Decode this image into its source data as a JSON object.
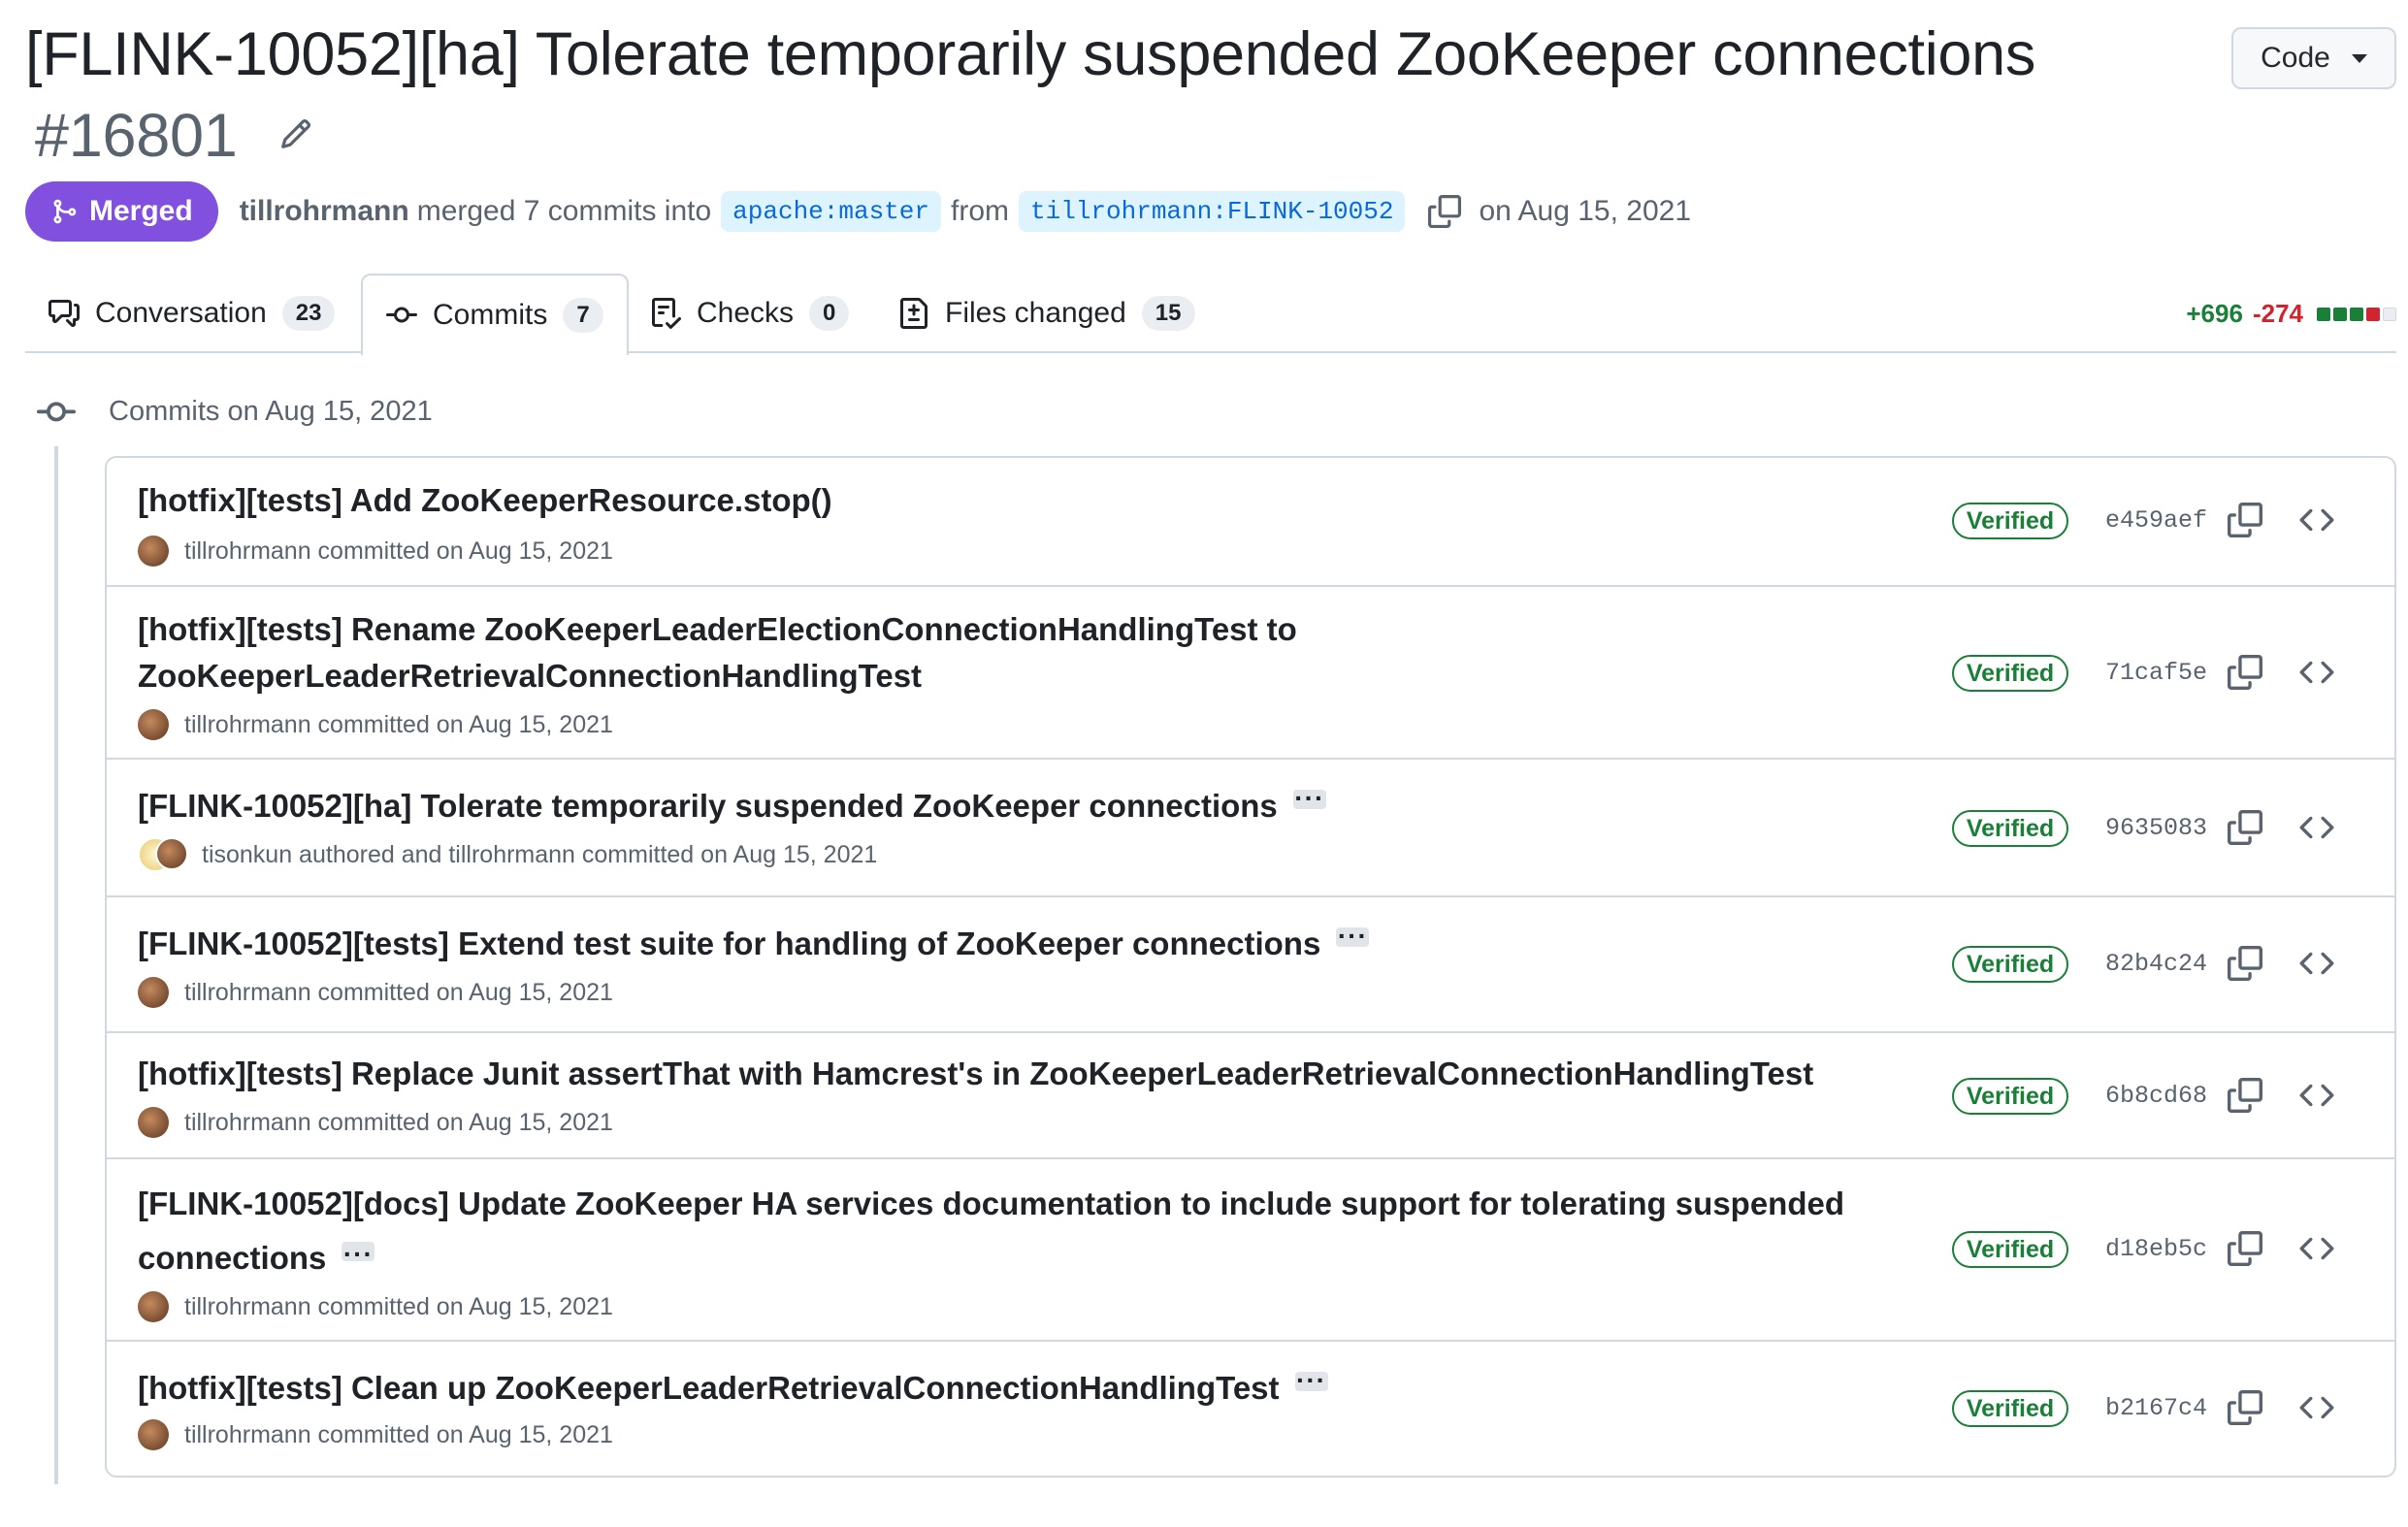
{
  "pr": {
    "title": "[FLINK-10052][ha] Tolerate temporarily suspended ZooKeeper connections",
    "number": "#16801",
    "code_label": "Code",
    "status": "Merged",
    "author": "tillrohrmann",
    "merge_text": "merged 7 commits into",
    "base_branch": "apache:master",
    "from_text": "from",
    "head_branch": "tillrohrmann:FLINK-10052",
    "date_text": "on Aug 15, 2021"
  },
  "tabs": [
    {
      "label": "Conversation",
      "count": "23",
      "icon": "comment-discussion-icon"
    },
    {
      "label": "Commits",
      "count": "7",
      "icon": "git-commit-icon",
      "active": true
    },
    {
      "label": "Checks",
      "count": "0",
      "icon": "checklist-icon"
    },
    {
      "label": "Files changed",
      "count": "15",
      "icon": "file-diff-icon"
    }
  ],
  "diffstat": {
    "additions": "+696",
    "deletions": "-274"
  },
  "colors": {
    "merged": "#8250df",
    "verified": "#1a7f37",
    "link": "#0969da",
    "add": "#1a7f37",
    "del": "#d1242f"
  },
  "commits_header": "Commits on Aug 15, 2021",
  "commits": [
    {
      "line1": "[hotfix][tests] Add ZooKeeperResource.stop()",
      "line2": "",
      "byline": "tillrohrmann committed on Aug 15, 2021",
      "badge": "Verified",
      "sha": "e459aef"
    },
    {
      "line1": "[hotfix][tests] Rename ZooKeeperLeaderElectionConnectionHandlingTest to",
      "line2": "ZooKeeperLeaderRetrievalConnectionHandlingTest",
      "byline": "tillrohrmann committed on Aug 15, 2021",
      "badge": "Verified",
      "sha": "71caf5e"
    },
    {
      "line1": "[FLINK-10052][ha] Tolerate temporarily suspended ZooKeeper connections",
      "line2": "",
      "byline": "tisonkun authored and tillrohrmann committed on Aug 15, 2021",
      "badge": "Verified",
      "sha": "9635083"
    },
    {
      "line1": "[FLINK-10052][tests] Extend test suite for handling of ZooKeeper connections",
      "line2": "",
      "byline": "tillrohrmann committed on Aug 15, 2021",
      "badge": "Verified",
      "sha": "82b4c24"
    },
    {
      "line1": "[hotfix][tests] Replace Junit assertThat with Hamcrest's in ZooKeeperLeaderRetrievalConnectionHandlingTest",
      "line2": "",
      "byline": "tillrohrmann committed on Aug 15, 2021",
      "badge": "Verified",
      "sha": "6b8cd68"
    },
    {
      "line1": "[FLINK-10052][docs] Update ZooKeeper HA services documentation to include support for tolerating suspended",
      "line2": "connections",
      "byline": "tillrohrmann committed on Aug 15, 2021",
      "badge": "Verified",
      "sha": "d18eb5c"
    },
    {
      "line1": "[hotfix][tests] Clean up ZooKeeperLeaderRetrievalConnectionHandlingTest",
      "line2": "",
      "byline": "tillrohrmann committed on Aug 15, 2021",
      "badge": "Verified",
      "sha": "b2167c4"
    }
  ]
}
